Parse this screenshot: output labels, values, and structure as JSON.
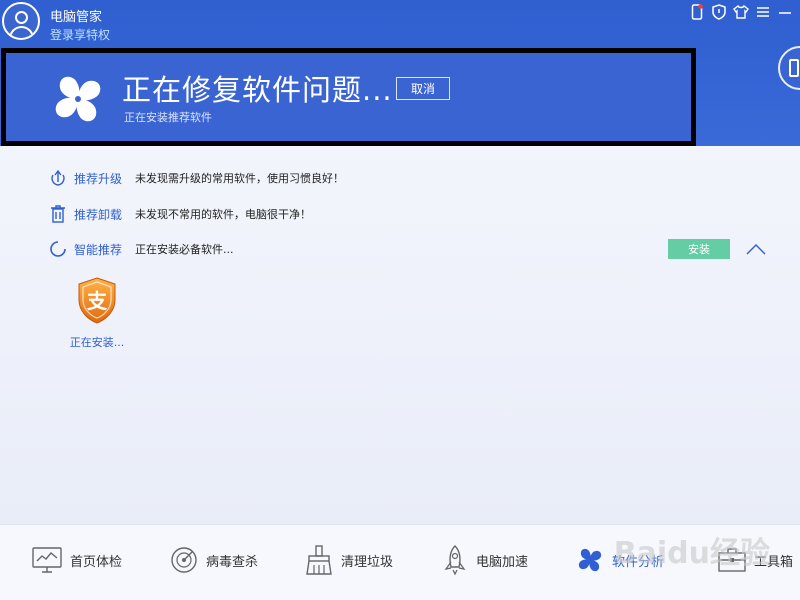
{
  "header": {
    "app_title": "电脑管家",
    "login_link": "登录享特权"
  },
  "banner": {
    "title": "正在修复软件问题...",
    "cancel_label": "取消",
    "subtitle": "正在安装推荐软件"
  },
  "rows": [
    {
      "label": "推荐升级",
      "text": "未发现需升级的常用软件，使用习惯良好！"
    },
    {
      "label": "推荐卸载",
      "text": "未发现不常用的软件，电脑很干净！"
    },
    {
      "label": "智能推荐",
      "text": "正在安装必备软件..."
    }
  ],
  "install_label": "安装",
  "app_tile": {
    "logo_char": "支",
    "status": "正在安装..."
  },
  "nav": [
    {
      "label": "首页体检",
      "icon": "monitor-icon"
    },
    {
      "label": "病毒查杀",
      "icon": "radar-icon"
    },
    {
      "label": "清理垃圾",
      "icon": "broom-icon"
    },
    {
      "label": "电脑加速",
      "icon": "rocket-icon"
    },
    {
      "label": "软件分析",
      "icon": "fan-icon"
    },
    {
      "label": "工具箱",
      "icon": "toolbox-icon"
    }
  ],
  "watermark": "Baidu经验",
  "colors": {
    "header_blue": "#3a64d2",
    "accent_blue": "#2f5fd0",
    "install_green": "#64cda4",
    "app_orange": "#f0842a"
  }
}
